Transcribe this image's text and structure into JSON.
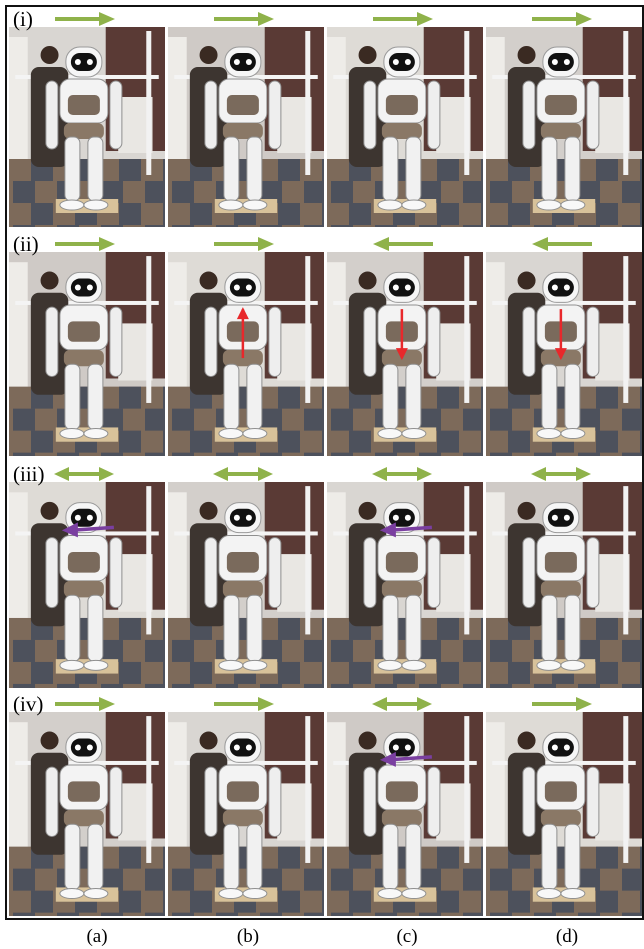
{
  "rows": [
    {
      "id": "i",
      "label": "(i)",
      "arrows": [
        "right",
        "right",
        "right",
        "right"
      ],
      "indicators": [
        "none",
        "none",
        "none",
        "none"
      ]
    },
    {
      "id": "ii",
      "label": "(ii)",
      "arrows": [
        "right",
        "right",
        "left",
        "left"
      ],
      "indicators": [
        "none",
        "red-up",
        "red-down",
        "red-down"
      ]
    },
    {
      "id": "iii",
      "label": "(iii)",
      "arrows": [
        "both",
        "both",
        "both",
        "both"
      ],
      "indicators": [
        "purple-left",
        "none",
        "purple-left",
        "none"
      ]
    },
    {
      "id": "iv",
      "label": "(iv)",
      "arrows": [
        "right",
        "right",
        "both",
        "right"
      ],
      "indicators": [
        "none",
        "none",
        "purple-left",
        "none"
      ]
    }
  ],
  "columns": [
    "(a)",
    "(b)",
    "(c)",
    "(d)"
  ],
  "colors": {
    "direction_arrow": "#8fb24a",
    "indicator_red": "#e8282b",
    "indicator_purple": "#7a3fa0",
    "frame": "#111111"
  }
}
